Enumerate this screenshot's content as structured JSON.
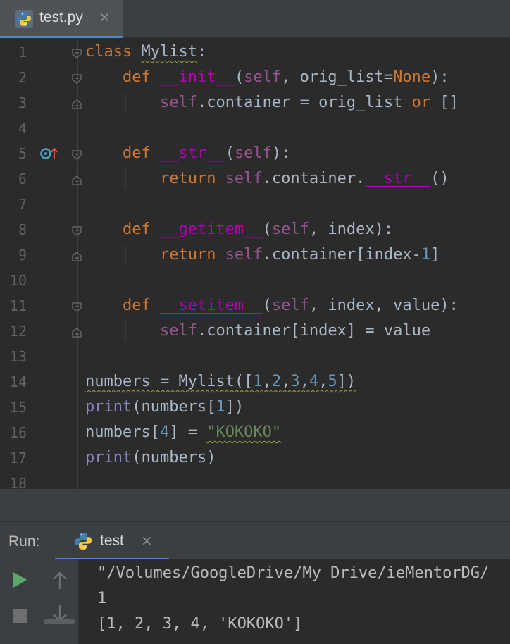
{
  "editor_tab": {
    "filename": "test.py",
    "close_glyph": "×",
    "icon": "python-file-icon"
  },
  "code_lines": [
    {
      "num": "1",
      "tokens": [
        {
          "t": "class ",
          "c": "k-kw"
        },
        {
          "t": "Mylist",
          "c": "warn"
        },
        {
          "t": ":",
          "c": ""
        }
      ]
    },
    {
      "num": "2",
      "tokens": [
        {
          "t": "    def ",
          "c": "k-kw"
        },
        {
          "t": "__init__",
          "c": "k-mag magic"
        },
        {
          "t": "(",
          "c": ""
        },
        {
          "t": "self",
          "c": "k-self"
        },
        {
          "t": ", orig_list=",
          "c": ""
        },
        {
          "t": "None",
          "c": "k-kw"
        },
        {
          "t": "):",
          "c": ""
        }
      ]
    },
    {
      "num": "3",
      "tokens": [
        {
          "t": "        ",
          "c": ""
        },
        {
          "t": "self",
          "c": "k-self"
        },
        {
          "t": ".container = orig_list ",
          "c": ""
        },
        {
          "t": "or",
          "c": "k-kw"
        },
        {
          "t": " []",
          "c": ""
        }
      ]
    },
    {
      "num": "4",
      "tokens": []
    },
    {
      "num": "5",
      "tokens": [
        {
          "t": "    def ",
          "c": "k-kw"
        },
        {
          "t": "__str__",
          "c": "k-mag magic"
        },
        {
          "t": "(",
          "c": ""
        },
        {
          "t": "self",
          "c": "k-self"
        },
        {
          "t": "):",
          "c": ""
        }
      ]
    },
    {
      "num": "6",
      "tokens": [
        {
          "t": "        ",
          "c": ""
        },
        {
          "t": "return ",
          "c": "k-kw"
        },
        {
          "t": "self",
          "c": "k-self"
        },
        {
          "t": ".container.",
          "c": ""
        },
        {
          "t": "__str__",
          "c": "k-mag magic"
        },
        {
          "t": "()",
          "c": ""
        }
      ]
    },
    {
      "num": "7",
      "tokens": []
    },
    {
      "num": "8",
      "tokens": [
        {
          "t": "    def ",
          "c": "k-kw"
        },
        {
          "t": "__getitem__",
          "c": "k-mag magic"
        },
        {
          "t": "(",
          "c": ""
        },
        {
          "t": "self",
          "c": "k-self"
        },
        {
          "t": ", index):",
          "c": ""
        }
      ]
    },
    {
      "num": "9",
      "tokens": [
        {
          "t": "        ",
          "c": ""
        },
        {
          "t": "return ",
          "c": "k-kw"
        },
        {
          "t": "self",
          "c": "k-self"
        },
        {
          "t": ".container[index-",
          "c": ""
        },
        {
          "t": "1",
          "c": "k-num"
        },
        {
          "t": "]",
          "c": ""
        }
      ]
    },
    {
      "num": "10",
      "tokens": []
    },
    {
      "num": "11",
      "tokens": [
        {
          "t": "    def ",
          "c": "k-kw"
        },
        {
          "t": "__setitem__",
          "c": "k-mag magic"
        },
        {
          "t": "(",
          "c": ""
        },
        {
          "t": "self",
          "c": "k-self"
        },
        {
          "t": ", index, value):",
          "c": ""
        }
      ]
    },
    {
      "num": "12",
      "tokens": [
        {
          "t": "        ",
          "c": ""
        },
        {
          "t": "self",
          "c": "k-self"
        },
        {
          "t": ".container[index] = value",
          "c": ""
        }
      ]
    },
    {
      "num": "13",
      "tokens": []
    },
    {
      "num": "14",
      "tokens": [
        {
          "t": "numbers = Mylist([",
          "c": "warn"
        },
        {
          "t": "1",
          "c": "k-num warn"
        },
        {
          "t": ",",
          "c": "warn"
        },
        {
          "t": "2",
          "c": "k-num warn"
        },
        {
          "t": ",",
          "c": "warn"
        },
        {
          "t": "3",
          "c": "k-num warn"
        },
        {
          "t": ",",
          "c": "warn"
        },
        {
          "t": "4",
          "c": "k-num warn"
        },
        {
          "t": ",",
          "c": "warn"
        },
        {
          "t": "5",
          "c": "k-num warn"
        },
        {
          "t": "])",
          "c": "warn"
        }
      ]
    },
    {
      "num": "15",
      "tokens": [
        {
          "t": "print",
          "c": "k-bi"
        },
        {
          "t": "(numbers[",
          "c": ""
        },
        {
          "t": "1",
          "c": "k-num"
        },
        {
          "t": "])",
          "c": ""
        }
      ]
    },
    {
      "num": "16",
      "tokens": [
        {
          "t": "numbers[",
          "c": ""
        },
        {
          "t": "4",
          "c": "k-num"
        },
        {
          "t": "] = ",
          "c": ""
        },
        {
          "t": "\"KOKOKO\"",
          "c": "k-str warn"
        }
      ]
    },
    {
      "num": "17",
      "tokens": [
        {
          "t": "print",
          "c": "k-bi"
        },
        {
          "t": "(numbers)",
          "c": ""
        }
      ]
    },
    {
      "num": "18",
      "tokens": []
    }
  ],
  "run_panel": {
    "label": "Run:",
    "tab_name": "test",
    "tab_close": "×",
    "output": [
      "\"/Volumes/GoogleDrive/My Drive/ieMentorDG/",
      "1",
      "[1, 2, 3, 4, 'KOKOKO']"
    ],
    "tools": [
      "run-icon",
      "stop-icon",
      "scroll-up-icon",
      "scroll-down-icon"
    ]
  },
  "colors": {
    "editor_bg": "#2b2b2b",
    "keyword": "#cc7832",
    "magic_method": "#b200b2",
    "self": "#94558d",
    "number": "#6897bb",
    "string": "#6a8759",
    "builtin": "#8888c6",
    "accent": "#4a88c7",
    "run_green": "#59a869"
  }
}
